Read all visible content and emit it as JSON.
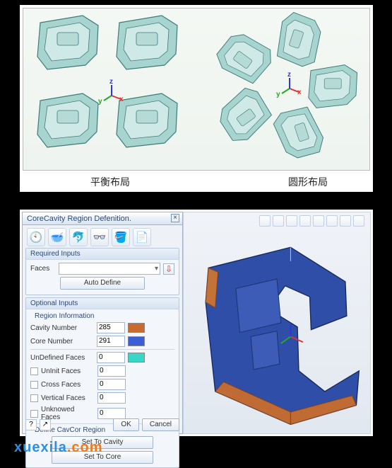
{
  "top": {
    "left_label": "平衡布局",
    "right_label": "圆形布局",
    "axes": {
      "x": "x",
      "y": "y",
      "z": "z"
    }
  },
  "dialog": {
    "title": "CoreCavity Region Defenition.",
    "close": "×",
    "toolbar_icons": [
      "🕙",
      "🥣",
      "🐬",
      "👓",
      "🪣",
      "📄"
    ],
    "required": {
      "header": "Required Inputs",
      "faces_label": "Faces",
      "faces_value": "",
      "auto_define": "Auto Define"
    },
    "optional": {
      "header": "Optional Inputs",
      "region_hd": "Region Information",
      "cavity_label": "Cavity Number",
      "cavity_value": "285",
      "cavity_color": "#c96a2e",
      "core_label": "Core Number",
      "core_value": "291",
      "core_color": "#3a5fd4",
      "undef_hd": "UnDefined Faces",
      "undef_value": "0",
      "undef_color": "#39d7c6",
      "uninit_label": "UnInit Faces",
      "uninit_value": "0",
      "cross_label": "Cross Faces",
      "cross_value": "0",
      "vertical_label": "Vertical Faces",
      "vertical_value": "0",
      "unknown_label": "Unknowed Faces",
      "unknown_value": "0",
      "define_hd": "Define CavCor Region",
      "set_cavity": "Set To Cavity",
      "set_core": "Set To Core"
    },
    "footer": {
      "ok": "OK",
      "cancel": "Cancel",
      "help": "?",
      "arrow": "↗"
    }
  },
  "viewport": {
    "toolbar_count": 8,
    "coord": {
      "x": "x",
      "y": "y",
      "z": "z"
    }
  },
  "watermark": {
    "text1": "xuexila",
    "text2": ".com"
  }
}
